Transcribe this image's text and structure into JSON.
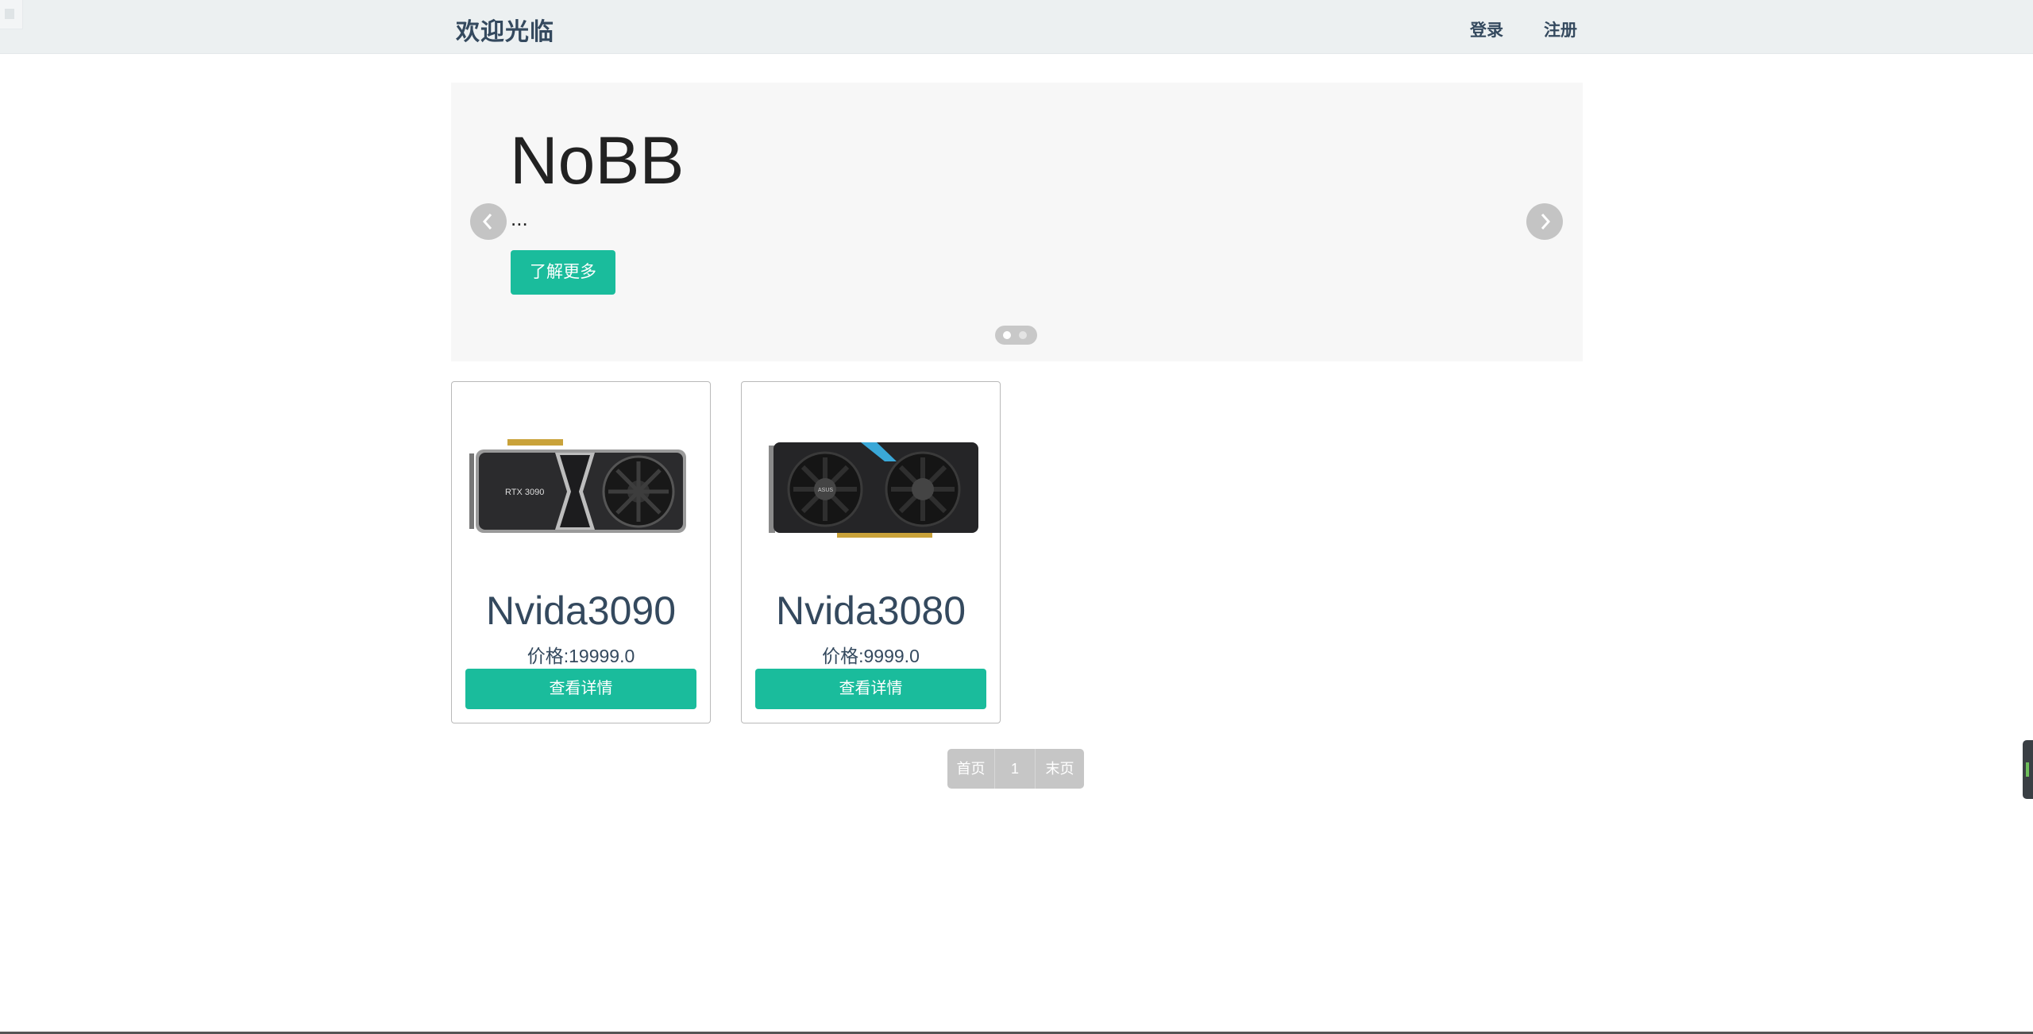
{
  "nav": {
    "brand": "欢迎光临",
    "login": "登录",
    "register": "注册"
  },
  "carousel": {
    "title": "NoBB",
    "subtitle": "...",
    "button_label": "了解更多",
    "slide_count": 2,
    "active_slide": 1,
    "prev_icon": "chevron-left-icon",
    "next_icon": "chevron-right-icon"
  },
  "products": [
    {
      "name": "Nvida3090",
      "price": "价格:19999.0",
      "button_label": "查看详情",
      "image_label": "RTX 3090",
      "image_icon": "graphics-card-image"
    },
    {
      "name": "Nvida3080",
      "price": "价格:9999.0",
      "button_label": "查看详情",
      "image_label": "ASUS",
      "image_icon": "graphics-card-image"
    }
  ],
  "pagination": {
    "first": "首页",
    "current": "1",
    "last": "末页"
  },
  "colors": {
    "accent": "#1abc9c",
    "text": "#34495e",
    "navbar_bg": "#ecf0f1",
    "pager_bg": "#c6c6c6"
  }
}
